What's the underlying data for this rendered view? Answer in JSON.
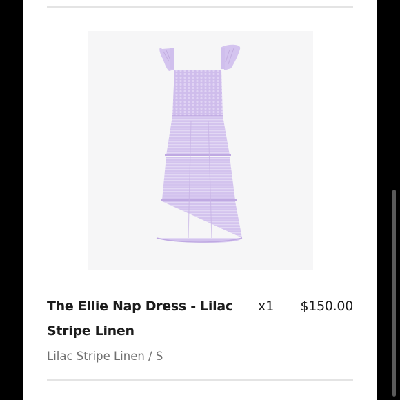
{
  "colors": {
    "page_background": "#000000",
    "card_background": "#ffffff",
    "title_text": "#1c1c1c",
    "variant_text": "#6f6f6f",
    "divider": "#e4e4e4",
    "dress_lilac": "#cdbbea"
  },
  "line_item": {
    "image_icon": "lilac-dress-image",
    "title": "The Ellie Nap Dress - Lilac Stripe Linen",
    "quantity": "x1",
    "price": "$150.00",
    "variant": "Lilac Stripe Linen / S"
  }
}
